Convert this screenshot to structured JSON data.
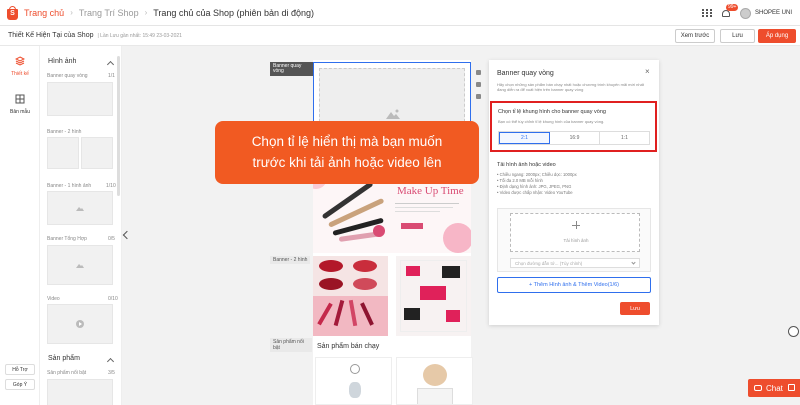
{
  "topbar": {
    "home": "Trang chủ",
    "crumbs": [
      "Trang Trí Shop",
      "Trang chủ của Shop (phiên bản di động)"
    ],
    "badge": "99+",
    "username": "SHOPEE UNI"
  },
  "subbar": {
    "title": "Thiết Kế Hiện Tại của Shop",
    "saved": "| Lần Lưu gần nhất: 15:49 23-03-2021",
    "preview": "Xem trước",
    "save": "Lưu",
    "apply": "Áp dụng"
  },
  "leftnav": {
    "design": "Thiết kế",
    "templates": "Bản mẫu",
    "support": "Hỗ Trợ",
    "feedback": "Góp Ý"
  },
  "components": {
    "images_heading": "Hình ảnh",
    "items": [
      {
        "label": "Banner quay vòng",
        "count": "1/1"
      },
      {
        "label": "Banner - 2 hình",
        "count": ""
      },
      {
        "label": "Banner - 1 hình ảnh",
        "count": "1/10"
      },
      {
        "label": "Banner Tổng Hợp",
        "count": "0/5"
      },
      {
        "label": "Video",
        "count": "0/10"
      }
    ],
    "products_heading": "Sản phẩm",
    "product_item": {
      "label": "Sản phẩm nổi bật",
      "count": "3/5"
    }
  },
  "canvas": {
    "selected_tag": "Banner quay vòng",
    "label_two_images": "Banner - 2 hình",
    "label_featured": "Sản phẩm nổi bật",
    "makeup_title": "Make Up Time",
    "best_sellers": "Sản phẩm bán chạy"
  },
  "settings": {
    "title": "Banner quay vòng",
    "close": "×",
    "desc": "Hãy chọn những sản phẩm bán chạy nhất hoặc chương trình khuyến mãi mới nhất đang diễn ra để xuất hiện trên banner quay vòng",
    "ratio_title": "Chọn tỉ lệ khung hình cho banner quay vòng",
    "ratio_sub": "Bạn có thể tùy chỉnh tỉ lệ khung hình của banner quay vòng.",
    "ratios": [
      "2:1",
      "16:9",
      "1:1"
    ],
    "upload_title": "Tải hình ảnh hoặc video",
    "upload_specs": [
      "• Chiều ngang: 2000px; Chiều dọc: 1000px",
      "• Tối đa 2.0 MB mỗi hình",
      "• Định dạng hình ảnh: JPG, JPEG, PNG",
      "• Video được chấp nhận: Video YouTube"
    ],
    "upload_label": "Tải hình ảnh",
    "link_placeholder": "Chọn đường dẫn tớ... (Tùy chỉnh)",
    "add_more": "+ Thêm Hình ảnh & Thêm Video(1/6)",
    "save": "Lưu"
  },
  "callout": {
    "line1": "Chọn tỉ lệ hiển thị mà bạn muốn",
    "line2": "trước khi tải ảnh hoặc video lên"
  },
  "chat": {
    "label": "Chat"
  },
  "colors": {
    "brand": "#ee4d2d",
    "accent": "#2f6fed",
    "highlight": "#e02020"
  }
}
